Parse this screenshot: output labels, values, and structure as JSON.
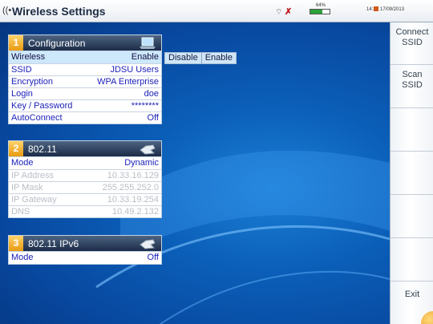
{
  "titlebar": {
    "icon": "wifi-icon",
    "title": "Wireless Settings",
    "battery_text": "64%",
    "battery_level": 0.64,
    "time": "14:31",
    "date": "17/09/2013",
    "colors": {
      "alert": "#c0141a",
      "battery": "#2aa33a"
    }
  },
  "panels": [
    {
      "num": "1",
      "title": "Configuration",
      "icon": "laptop-icon",
      "rows": [
        {
          "label": "Wireless",
          "value": "Enable"
        },
        {
          "label": "SSID",
          "value": "JDSU Users"
        },
        {
          "label": "Encryption",
          "value": "WPA Enterprise"
        },
        {
          "label": "Login",
          "value": "doe"
        },
        {
          "label": "Key / Password",
          "value": "********"
        },
        {
          "label": "AutoConnect",
          "value": "Off"
        }
      ]
    },
    {
      "num": "2",
      "title": "802.11",
      "icon": "hand-icon",
      "rows": [
        {
          "label": "Mode",
          "value": "Dynamic"
        },
        {
          "label": "IP Address",
          "value": "10.33.16.129"
        },
        {
          "label": "IP Mask",
          "value": "255.255.252.0"
        },
        {
          "label": "IP Gateway",
          "value": "10.33.19.254"
        },
        {
          "label": "DNS",
          "value": "10.49.2.132"
        }
      ]
    },
    {
      "num": "3",
      "title": "802.11 IPv6",
      "icon": "hand-icon",
      "rows": [
        {
          "label": "Mode",
          "value": "Off"
        }
      ]
    }
  ],
  "wireless_options": [
    "Disable",
    "Enable"
  ],
  "softkeys": [
    {
      "line1": "Connect",
      "line2": "SSID"
    },
    {
      "line1": "Scan",
      "line2": "SSID"
    },
    {
      "line1": "",
      "line2": ""
    },
    {
      "line1": "",
      "line2": ""
    },
    {
      "line1": "",
      "line2": ""
    },
    {
      "line1": "",
      "line2": ""
    },
    {
      "line1": "Exit",
      "line2": ""
    }
  ]
}
